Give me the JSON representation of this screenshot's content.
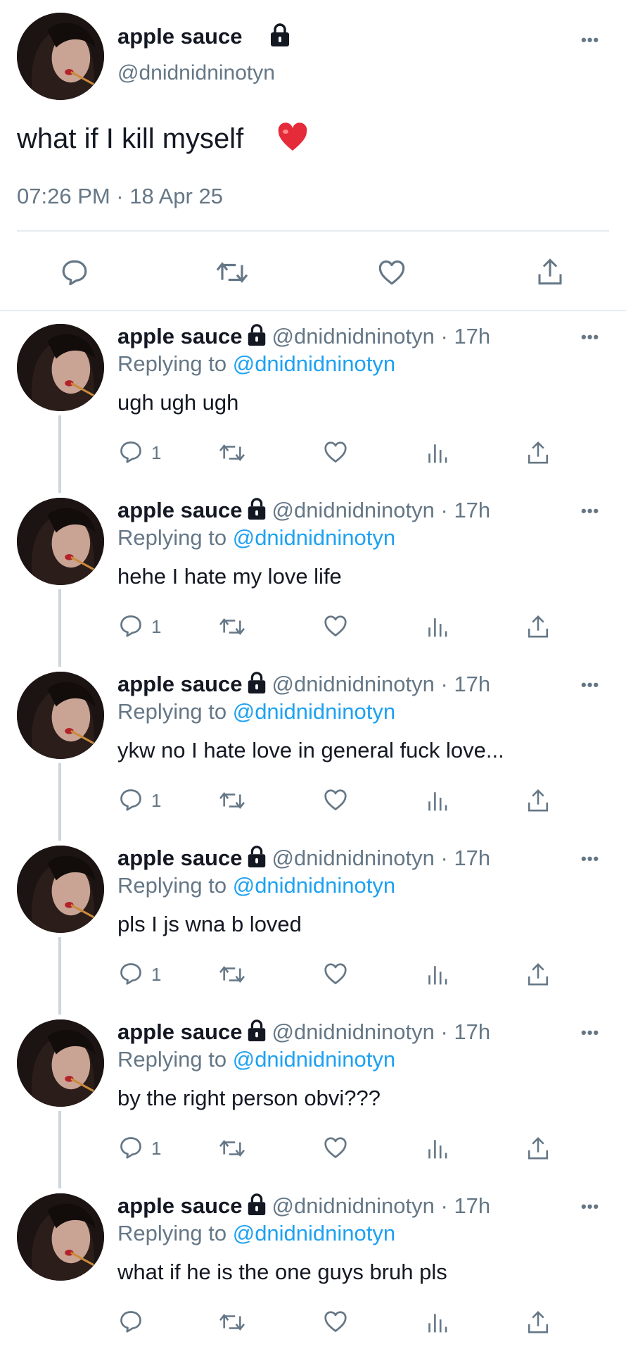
{
  "main_tweet": {
    "display_name": "apple sauce",
    "handle": "@dnidnidninotyn",
    "text": "what if I kill myself",
    "timestamp": "07:26 PM · 18 Apr 25",
    "icons": [
      "lock-icon",
      "heart-emoji",
      "more-icon",
      "reply-icon",
      "retweet-icon",
      "like-icon",
      "share-icon"
    ]
  },
  "replies": [
    {
      "display_name": "apple sauce",
      "meta": "@dnidnidninotyn · 17h",
      "replying_prefix": "Replying to",
      "replying_handle": "@dnidnidninotyn",
      "text": "ugh ugh ugh",
      "reply_count": "1"
    },
    {
      "display_name": "apple sauce",
      "meta": "@dnidnidninotyn · 17h",
      "replying_prefix": "Replying to",
      "replying_handle": "@dnidnidninotyn",
      "text": "hehe I hate my love life",
      "reply_count": "1"
    },
    {
      "display_name": "apple sauce",
      "meta": "@dnidnidninotyn · 17h",
      "replying_prefix": "Replying to",
      "replying_handle": "@dnidnidninotyn",
      "text": "ykw no I hate love in general fuck love...",
      "reply_count": "1"
    },
    {
      "display_name": "apple sauce",
      "meta": "@dnidnidninotyn · 17h",
      "replying_prefix": "Replying to",
      "replying_handle": "@dnidnidninotyn",
      "text": "pls I js wna b loved",
      "reply_count": "1"
    },
    {
      "display_name": "apple sauce",
      "meta": "@dnidnidninotyn · 17h",
      "replying_prefix": "Replying to",
      "replying_handle": "@dnidnidninotyn",
      "text": "by the right person obvi???",
      "reply_count": "1"
    },
    {
      "display_name": "apple sauce",
      "meta": "@dnidnidninotyn · 17h",
      "replying_prefix": "Replying to",
      "replying_handle": "@dnidnidninotyn",
      "text": "what if he is the one guys bruh pls",
      "reply_count": ""
    }
  ],
  "colors": {
    "text": "#141823",
    "secondary": "#657786",
    "link": "#1da1f2",
    "divider": "#e6ecf0",
    "thread_line": "#ccd6dd"
  }
}
